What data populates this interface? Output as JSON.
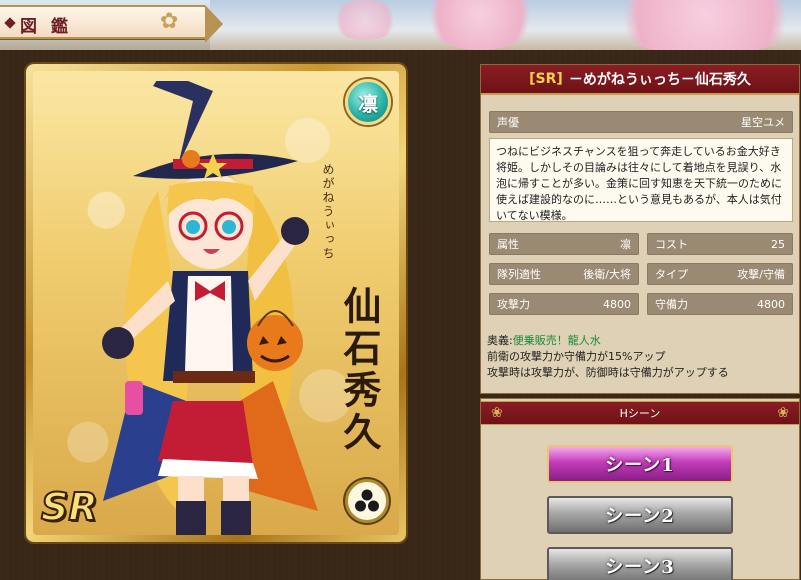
{
  "header": {
    "title": "図鑑"
  },
  "card": {
    "attribute_badge": "凛",
    "kana_name": "めがねうぃっち",
    "kanji_name": "仙石秀久",
    "rarity": "SR",
    "crest_icon": "crest-icon"
  },
  "character": {
    "rarity": "[SR]",
    "title": "－めがねうぃっち－仙石秀久",
    "voice_label": "声優",
    "voice_value": "星空ユメ",
    "description": "つねにビジネスチャンスを狙って奔走しているお金大好き将姫。しかしその目論みは往々にして着地点を見誤り、水泡に帰すことが多い。金策に回す知恵を天下統一のために使えば建設的なのに……という意見もあるが、本人は気付いてない模様。",
    "stats": {
      "attribute_label": "属性",
      "attribute_value": "凛",
      "cost_label": "コスト",
      "cost_value": "25",
      "formation_label": "隊列適性",
      "formation_value": "後衛/大将",
      "type_label": "タイプ",
      "type_value": "攻撃/守備",
      "attack_label": "攻撃力",
      "attack_value": "4800",
      "defense_label": "守備力",
      "defense_value": "4800"
    },
    "skill": {
      "prefix": "奥義:",
      "name": "便乗販売！龍人水",
      "line1": "前衛の攻撃力か守備力が15%アップ",
      "line2": "攻撃時は攻撃力が、防御時は守備力がアップする"
    }
  },
  "hscene": {
    "header": "Hシーン",
    "scenes": [
      "シーン1",
      "シーン2",
      "シーン3"
    ]
  },
  "colors": {
    "accent_red": "#7c171c",
    "gold": "#c79c4c",
    "active_pink": "#c13cb8"
  }
}
